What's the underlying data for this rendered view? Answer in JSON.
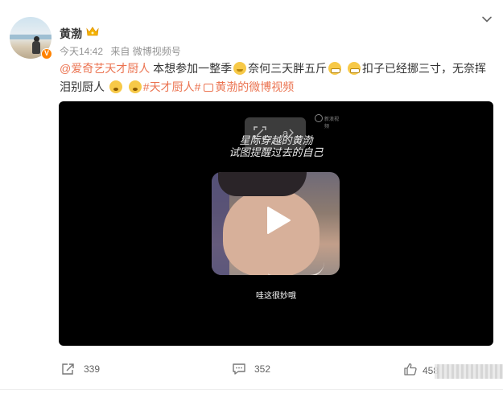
{
  "user": {
    "name": "黄渤",
    "verified_badge": "V",
    "meta_time": "今天14:42",
    "meta_source": "来自 微博视频号"
  },
  "post": {
    "mention": "@爱奇艺天才厨人",
    "text_1": " 本想参加一整季",
    "text_2": "奈何三天胖五斤",
    "text_3": "扣子已经挪三寸，无奈挥泪别厨人",
    "hashtag": "#天才厨人#",
    "video_link": "黄渤的微博视频"
  },
  "video": {
    "subtitle_line1": "星际穿越的黄渤",
    "subtitle_line2": "试图提醒过去的自己",
    "caption": "哇这很妙哦",
    "watermark": "新浪视频"
  },
  "actions": {
    "repost_count": "339",
    "comment_count": "352",
    "like_count": "458"
  },
  "icons": {
    "crown": "crown-icon",
    "chevron": "chevron-down-icon",
    "repost": "repost-icon",
    "comment": "comment-icon",
    "like": "like-icon",
    "play": "play-icon"
  },
  "colors": {
    "accent": "#eb7350",
    "badge": "#ff8200",
    "meta": "#939393"
  }
}
